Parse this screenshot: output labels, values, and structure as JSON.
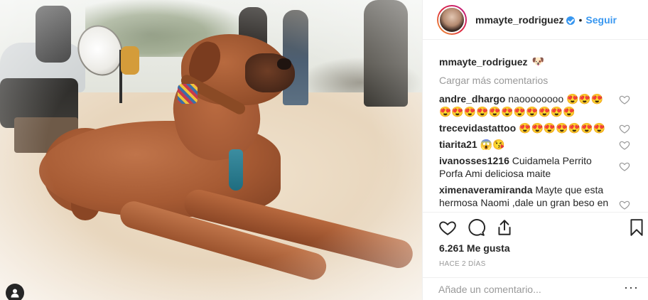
{
  "post": {
    "username": "mmayte_rodriguez",
    "follow_label": "Seguir",
    "separator": "•",
    "caption_user": "mmayte_rodriguez",
    "caption_emoji": "🐶",
    "load_more_label": "Cargar más comentarios",
    "likes_text": "6.261 Me gusta",
    "timestamp": "HACE 2 DÍAS",
    "comment_placeholder": "Añade un comentario...",
    "more_label": "···"
  },
  "comments": [
    {
      "user": "andre_dhargo",
      "text": "naoooooooo 😍😍😍😍😍😍😍😍😍😍😍😍😍😍"
    },
    {
      "user": "trecevidastattoo",
      "text": "😍😍😍😍😍😍😍"
    },
    {
      "user": "tiarita21",
      "text": "😱😘"
    },
    {
      "user": "ivanosses1216",
      "text": "Cuidamela Perrito Porfa Ami deliciosa maite"
    },
    {
      "user": "ximenaveramiranda",
      "text": "Mayte que esta hermosa Naomi ,dale un gran beso en"
    }
  ],
  "colors": {
    "link": "#3897f0",
    "text": "#262626",
    "muted": "#999999"
  },
  "icons": [
    "heart-icon",
    "comment-icon",
    "share-icon",
    "bookmark-icon",
    "user-tag-icon",
    "verified-badge-icon",
    "more-options-icon"
  ]
}
